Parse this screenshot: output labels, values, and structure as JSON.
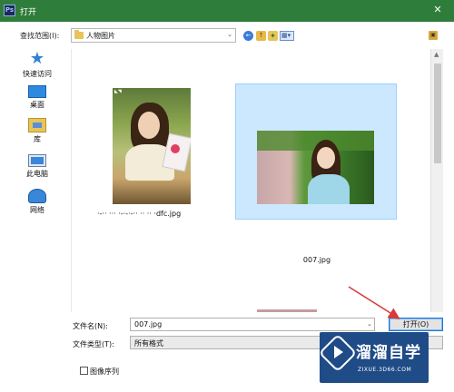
{
  "window": {
    "title": "打开",
    "app_icon_text": "Ps",
    "close_glyph": "✕"
  },
  "toolbar": {
    "lookin_label": "查找范围(I):",
    "lookin_value": "人物图片",
    "combo_arrow": "⌄",
    "icons": [
      "back-icon",
      "up-folder-icon",
      "new-folder-icon",
      "view-menu-icon",
      "tools-icon"
    ],
    "view_glyph": "▦▾"
  },
  "places": [
    {
      "label": "快速访问",
      "icon": "star-icon"
    },
    {
      "label": "桌面",
      "icon": "desktop-icon"
    },
    {
      "label": "库",
      "icon": "library-icon"
    },
    {
      "label": "此电脑",
      "icon": "computer-icon"
    },
    {
      "label": "网络",
      "icon": "network-icon"
    }
  ],
  "files": [
    {
      "name": "·-·· ··· ·-·-·-·· ·· ·· ·dfc.jpg",
      "selected": false,
      "photo_mark": "◣◥"
    },
    {
      "name": "007.jpg",
      "selected": true
    }
  ],
  "bottom": {
    "filename_label": "文件名(N):",
    "filename_value": "007.jpg",
    "filetype_label": "文件类型(T):",
    "filetype_value": "所有格式",
    "open_button": "打开(O)",
    "image_sequence_label": "图像序列"
  },
  "watermark": {
    "text": "溜溜自学",
    "sub": "ZIXUE.3D66.COM"
  },
  "colors": {
    "titlebar": "#2f7d3a",
    "selection": "#cce8ff",
    "arrow": "#d83a3a",
    "watermark_bg": "#1f4b86"
  }
}
